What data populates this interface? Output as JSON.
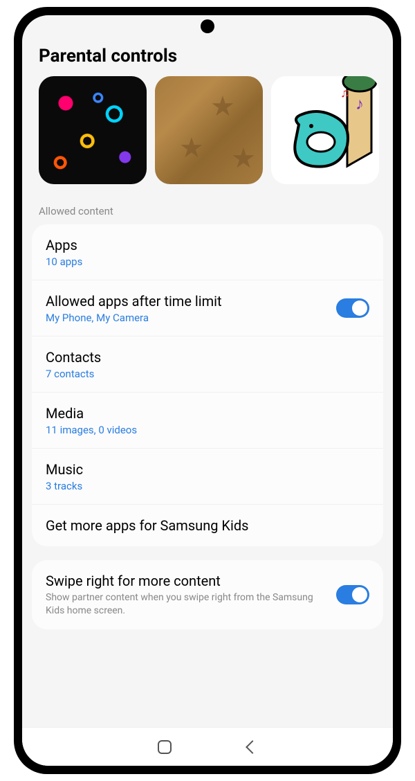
{
  "page": {
    "title": "Parental controls"
  },
  "section": {
    "allowed_header": "Allowed content"
  },
  "thumbnails": [
    {
      "name": "space-doodles"
    },
    {
      "name": "leather-stars"
    },
    {
      "name": "singing-whale"
    }
  ],
  "settings": {
    "apps": {
      "title": "Apps",
      "sub": "10 apps"
    },
    "allowed_after_limit": {
      "title": "Allowed apps after time limit",
      "sub": "My Phone, My Camera",
      "toggle": true
    },
    "contacts": {
      "title": "Contacts",
      "sub": "7 contacts"
    },
    "media": {
      "title": "Media",
      "sub": "11 images, 0 videos"
    },
    "music": {
      "title": "Music",
      "sub": "3 tracks"
    },
    "get_more": {
      "title": "Get more apps for Samsung Kids"
    }
  },
  "swipe": {
    "title": "Swipe right for more content",
    "desc": "Show partner content when you swipe right from the Samsung Kids home screen.",
    "toggle": true
  }
}
